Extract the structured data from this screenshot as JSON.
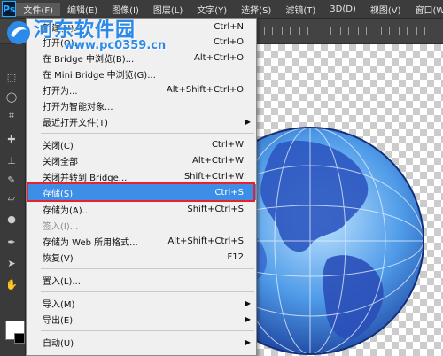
{
  "app": {
    "logo": "Ps"
  },
  "menubar": {
    "items": [
      {
        "label": "文件(F)"
      },
      {
        "label": "编辑(E)"
      },
      {
        "label": "图像(I)"
      },
      {
        "label": "图层(L)"
      },
      {
        "label": "文字(Y)"
      },
      {
        "label": "选择(S)"
      },
      {
        "label": "滤镜(T)"
      },
      {
        "label": "3D(D)"
      },
      {
        "label": "视图(V)"
      },
      {
        "label": "窗口(W)"
      }
    ]
  },
  "file_menu": {
    "items": [
      {
        "label": "新建(N)...",
        "shortcut": "Ctrl+N"
      },
      {
        "label": "打开(O)...",
        "shortcut": "Ctrl+O"
      },
      {
        "label": "在 Bridge 中浏览(B)...",
        "shortcut": "Alt+Ctrl+O"
      },
      {
        "label": "在 Mini Bridge 中浏览(G)...",
        "shortcut": ""
      },
      {
        "label": "打开为...",
        "shortcut": "Alt+Shift+Ctrl+O"
      },
      {
        "label": "打开为智能对象...",
        "shortcut": ""
      },
      {
        "label": "最近打开文件(T)",
        "shortcut": ""
      },
      {
        "label": "关闭(C)",
        "shortcut": "Ctrl+W"
      },
      {
        "label": "关闭全部",
        "shortcut": "Alt+Ctrl+W"
      },
      {
        "label": "关闭并转到 Bridge...",
        "shortcut": "Shift+Ctrl+W"
      },
      {
        "label": "存储(S)",
        "shortcut": "Ctrl+S"
      },
      {
        "label": "存储为(A)...",
        "shortcut": "Shift+Ctrl+S"
      },
      {
        "label": "签入(I)...",
        "shortcut": ""
      },
      {
        "label": "存储为 Web 所用格式...",
        "shortcut": "Alt+Shift+Ctrl+S"
      },
      {
        "label": "恢复(V)",
        "shortcut": "F12"
      },
      {
        "label": "置入(L)...",
        "shortcut": ""
      },
      {
        "label": "导入(M)",
        "shortcut": ""
      },
      {
        "label": "导出(E)",
        "shortcut": ""
      },
      {
        "label": "自动(U)",
        "shortcut": ""
      }
    ]
  },
  "watermark": {
    "title": "河东软件园",
    "url": "www.pc0359.cn"
  },
  "colors": {
    "highlight": "#3d8ee6",
    "annotation": "#e8212a",
    "watermark": "#2c8ae8"
  }
}
